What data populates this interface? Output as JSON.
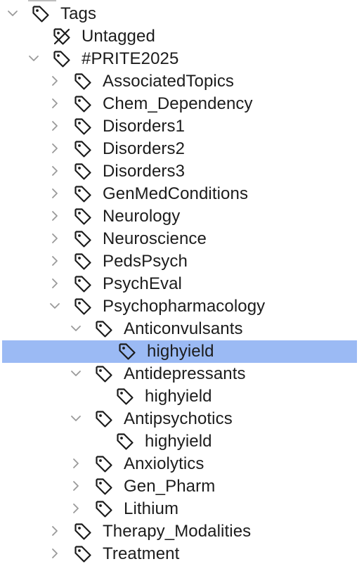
{
  "tree": {
    "rows": [
      {
        "label": "Tags",
        "icon": "tag-icon",
        "expander": "expanded",
        "selected": false
      },
      {
        "label": "Untagged",
        "icon": "untagged-icon",
        "expander": "none",
        "selected": false
      },
      {
        "label": "#PRITE2025",
        "icon": "tag-icon",
        "expander": "expanded",
        "selected": false
      },
      {
        "label": "AssociatedTopics",
        "icon": "tag-icon",
        "expander": "collapsed",
        "selected": false
      },
      {
        "label": "Chem_Dependency",
        "icon": "tag-icon",
        "expander": "collapsed",
        "selected": false
      },
      {
        "label": "Disorders1",
        "icon": "tag-icon",
        "expander": "collapsed",
        "selected": false
      },
      {
        "label": "Disorders2",
        "icon": "tag-icon",
        "expander": "collapsed",
        "selected": false
      },
      {
        "label": "Disorders3",
        "icon": "tag-icon",
        "expander": "collapsed",
        "selected": false
      },
      {
        "label": "GenMedConditions",
        "icon": "tag-icon",
        "expander": "collapsed",
        "selected": false
      },
      {
        "label": "Neurology",
        "icon": "tag-icon",
        "expander": "collapsed",
        "selected": false
      },
      {
        "label": "Neuroscience",
        "icon": "tag-icon",
        "expander": "collapsed",
        "selected": false
      },
      {
        "label": "PedsPsych",
        "icon": "tag-icon",
        "expander": "collapsed",
        "selected": false
      },
      {
        "label": "PsychEval",
        "icon": "tag-icon",
        "expander": "collapsed",
        "selected": false
      },
      {
        "label": "Psychopharmacology",
        "icon": "tag-icon",
        "expander": "expanded",
        "selected": false
      },
      {
        "label": "Anticonvulsants",
        "icon": "tag-icon",
        "expander": "expanded",
        "selected": false
      },
      {
        "label": "highyield",
        "icon": "tag-icon",
        "expander": "none",
        "selected": true
      },
      {
        "label": "Antidepressants",
        "icon": "tag-icon",
        "expander": "expanded",
        "selected": false
      },
      {
        "label": "highyield",
        "icon": "tag-icon",
        "expander": "none",
        "selected": false
      },
      {
        "label": "Antipsychotics",
        "icon": "tag-icon",
        "expander": "expanded",
        "selected": false
      },
      {
        "label": "highyield",
        "icon": "tag-icon",
        "expander": "none",
        "selected": false
      },
      {
        "label": "Anxiolytics",
        "icon": "tag-icon",
        "expander": "collapsed",
        "selected": false
      },
      {
        "label": "Gen_Pharm",
        "icon": "tag-icon",
        "expander": "collapsed",
        "selected": false
      },
      {
        "label": "Lithium",
        "icon": "tag-icon",
        "expander": "collapsed",
        "selected": false
      },
      {
        "label": "Therapy_Modalities",
        "icon": "tag-icon",
        "expander": "collapsed",
        "selected": false
      },
      {
        "label": "Treatment",
        "icon": "tag-icon",
        "expander": "collapsed",
        "selected": false
      }
    ]
  },
  "colors": {
    "selection": "#9bbaf4",
    "text": "#1c1c1c",
    "chevron": "#9a9a9a",
    "icon_stroke": "#1c1c1c"
  }
}
